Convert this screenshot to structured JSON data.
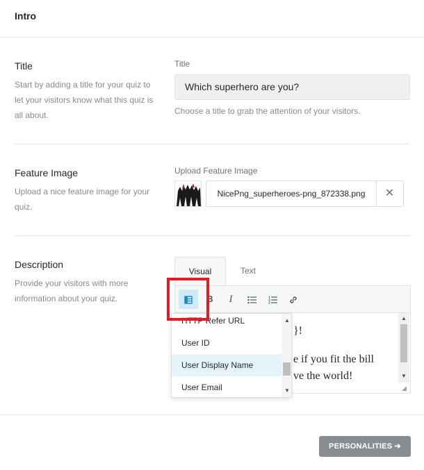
{
  "header": {
    "title": "Intro"
  },
  "title_section": {
    "heading": "Title",
    "description": "Start by adding a title for your quiz to let your visitors know what this quiz is all about.",
    "field_label": "Title",
    "value": "Which superhero are you?",
    "hint": "Choose a title to grab the attention of your visitors."
  },
  "feature_section": {
    "heading": "Feature Image",
    "description": "Upload a nice feature image for your quiz.",
    "field_label": "Upload Feature Image",
    "file_name": "NicePng_superheroes-png_872338.png",
    "clear_icon": "close-icon",
    "clear_glyph": "✕"
  },
  "description_section": {
    "heading": "Description",
    "description": "Provide your visitors with more information about your quiz.",
    "tabs": {
      "visual": "Visual",
      "text": "Text"
    },
    "toolbar": {
      "dynamic": "dynamic-field-icon",
      "bold": "B",
      "italic": "I",
      "bullets": "bullet-list-icon",
      "numbers": "numbered-list-icon",
      "link": "link-icon"
    },
    "editor_lines": [
      "}!",
      "e if you fit the bill",
      "ve the world!"
    ],
    "dropdown": {
      "items": [
        "HTTP Refer URL",
        "User ID",
        "User Display Name",
        "User Email"
      ],
      "selected": "User Display Name"
    }
  },
  "footer": {
    "next_label": "PERSONALITIES",
    "next_arrow": "➔"
  },
  "colors": {
    "highlight": "#e21b24",
    "accent": "#1e88c8",
    "button": "#8a8d90"
  }
}
